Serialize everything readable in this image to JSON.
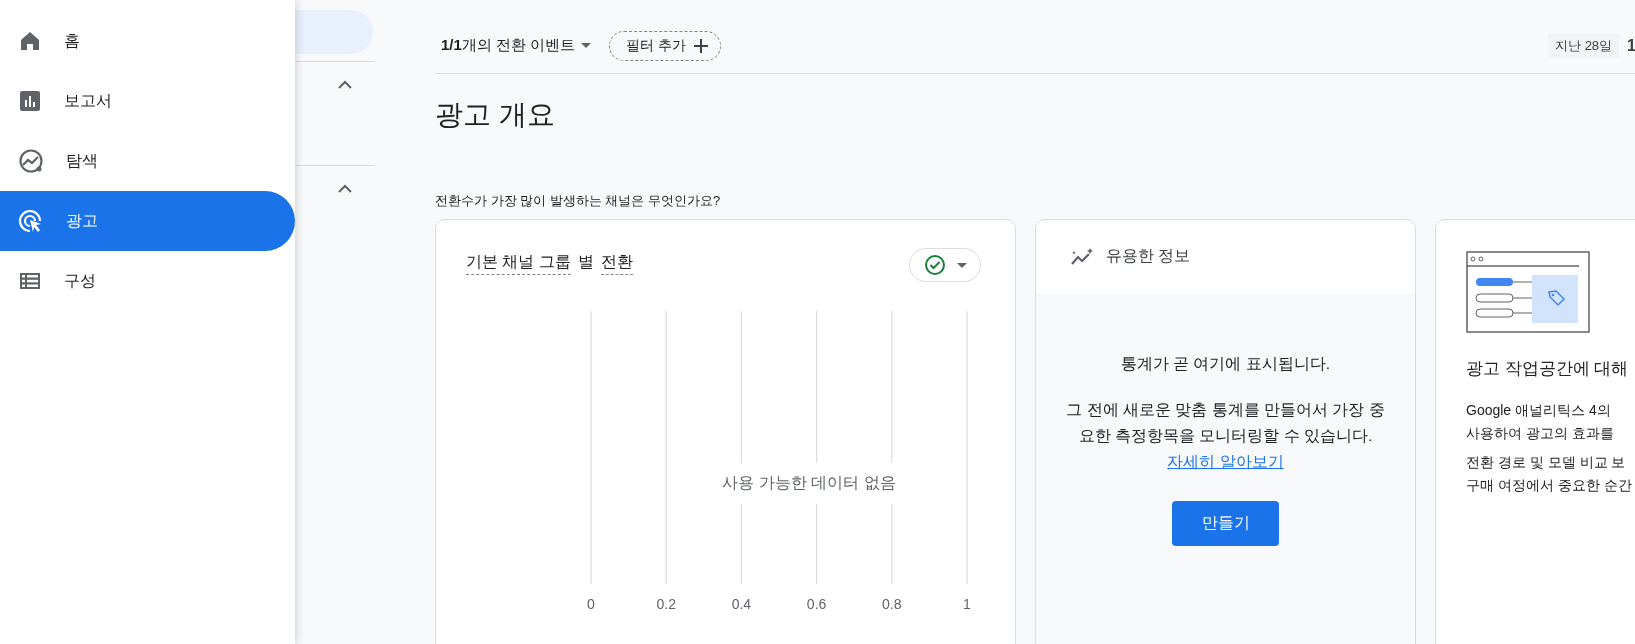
{
  "nav": {
    "items": [
      {
        "label": "홈",
        "selected": false
      },
      {
        "label": "보고서",
        "selected": false
      },
      {
        "label": "탐색",
        "selected": false
      },
      {
        "label": "광고",
        "selected": true
      },
      {
        "label": "구성",
        "selected": false
      }
    ]
  },
  "side_panel": {
    "sections": [
      {
        "expanded": true
      },
      {
        "expanded": true
      }
    ]
  },
  "toolbar": {
    "events_selector": "**1/1**개의 전환 이벤트",
    "filter_button": "필터 추가",
    "date_chip": "지난 28일",
    "date_range": "1"
  },
  "page_title": "광고 개요",
  "question": "전환수가 가장 많이 발생하는 채널은 무엇인가요?",
  "chart_card": {
    "title_parts": [
      {
        "text": "기본 채널 그룹",
        "underlined": true
      },
      {
        "text": "별",
        "underlined": false
      },
      {
        "text": "전환",
        "underlined": true
      }
    ],
    "status_ok": true,
    "no_data": "사용 가능한 데이터 없음",
    "axis_ticks": [
      "0",
      "0.2",
      "0.4",
      "0.6",
      "0.8",
      "1"
    ]
  },
  "insights_card": {
    "title": "유용한 정보",
    "headline": "통계가 곧 여기에 표시됩니다.",
    "body": "그 전에 새로운 맞춤 통계를 만들어서 가장 중요한 측정항목을 모니터링할 수 있습니다.",
    "link": "자세히 알아보기",
    "button": "만들기"
  },
  "about_card": {
    "title": "광고 작업공간에 대해",
    "paragraphs": [
      [
        "Google 애널리틱스 4의",
        "사용하여 광고의 효과를"
      ],
      [
        "전환 경로 및 모델 비교 보",
        "구매 여정에서 중요한 순간"
      ]
    ]
  }
}
